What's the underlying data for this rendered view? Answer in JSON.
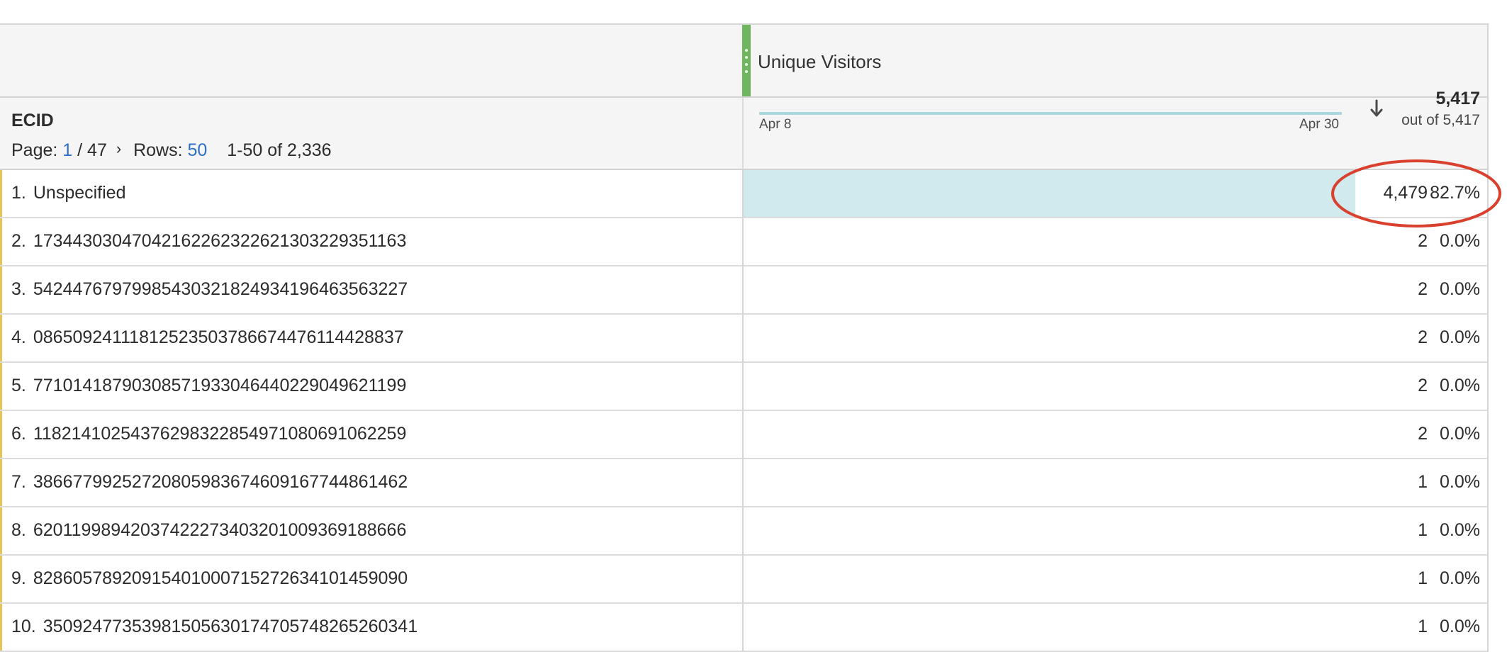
{
  "metric_column": {
    "title": "Unique Visitors"
  },
  "dimension_header": {
    "title": "ECID",
    "pager": {
      "page_label": "Page:",
      "current_page": "1",
      "total_pages": "/ 47",
      "next_icon": "chevron-right-icon",
      "rows_label": "Rows:",
      "rows_per_page": "50",
      "range": "1-50 of 2,336"
    },
    "sparkline": {
      "start_label": "Apr 8",
      "end_label": "Apr 30"
    },
    "sort_icon": "arrow-down-icon",
    "total": "5,417",
    "total_sub": "out of 5,417"
  },
  "rows": [
    {
      "num": "1.",
      "label": "Unspecified",
      "value": "4,479",
      "pct": "82.7%",
      "share": 0.827
    },
    {
      "num": "2.",
      "label": "17344303047042162262322621303229351163",
      "value": "2",
      "pct": "0.0%",
      "share": 0
    },
    {
      "num": "3.",
      "label": "54244767979985430321824934196463563227",
      "value": "2",
      "pct": "0.0%",
      "share": 0
    },
    {
      "num": "4.",
      "label": "08650924111812523503786674476114428837",
      "value": "2",
      "pct": "0.0%",
      "share": 0
    },
    {
      "num": "5.",
      "label": "77101418790308571933046440229049621199",
      "value": "2",
      "pct": "0.0%",
      "share": 0
    },
    {
      "num": "6.",
      "label": "11821410254376298322854971080691062259",
      "value": "2",
      "pct": "0.0%",
      "share": 0
    },
    {
      "num": "7.",
      "label": "38667799252720805983674609167744861462",
      "value": "1",
      "pct": "0.0%",
      "share": 0
    },
    {
      "num": "8.",
      "label": "62011998942037422273403201009369188666",
      "value": "1",
      "pct": "0.0%",
      "share": 0
    },
    {
      "num": "9.",
      "label": "82860578920915401000715272634101459090",
      "value": "1",
      "pct": "0.0%",
      "share": 0
    },
    {
      "num": "10.",
      "label": "35092477353981505630174705748265260341",
      "value": "1",
      "pct": "0.0%",
      "share": 0
    }
  ],
  "colors": {
    "metric_accent": "#6fb75f",
    "bar_fill": "#d0eaee",
    "row_accent": "#e5c45a",
    "link": "#2d6ec9",
    "annotation": "#d9412e"
  },
  "annotation_icon": "red-ellipse-annotation"
}
